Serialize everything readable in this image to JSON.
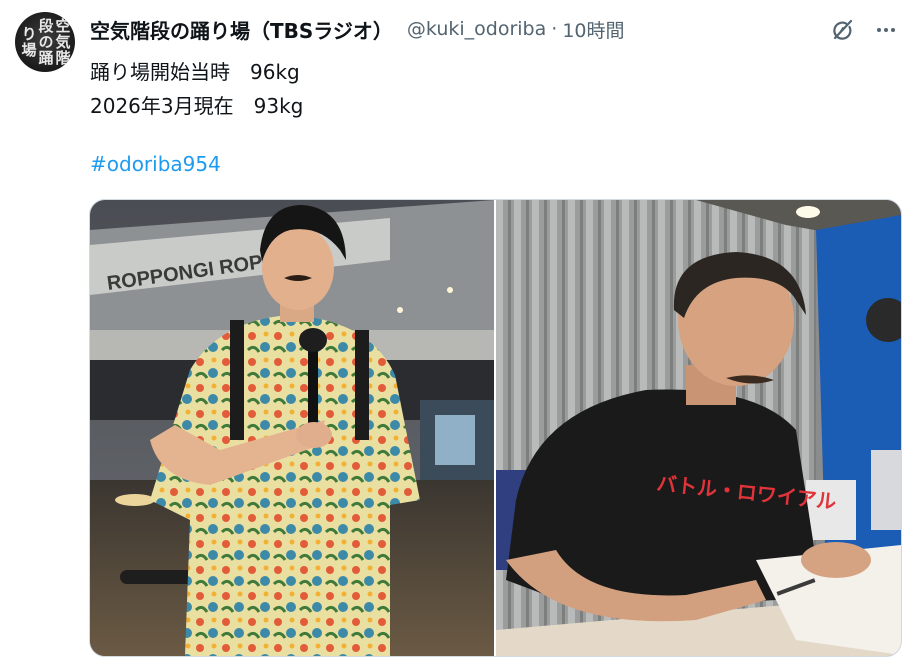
{
  "author": {
    "name": "空気階段の踊り場（TBSラジオ）",
    "handle": "@kuki_odoriba",
    "separator": "·",
    "time": "10時間",
    "avatar_text": "空気階段の踊り場"
  },
  "post": {
    "line1": "踊り場開始当時　96kg",
    "line2": "2026年3月現在　93kg",
    "hashtag": "#odoriba954"
  },
  "media": {
    "photo1": {
      "sign_text": "ROPPONGI ROPPONGI"
    },
    "photo2": {
      "shirt_text": "バトル・ロワイアル"
    }
  },
  "icons": {
    "grok": "grok-icon",
    "more": "more-dots-icon"
  },
  "colors": {
    "link": "#1d9bf0",
    "secondary_text": "#536471",
    "primary_text": "#0f1419",
    "border": "#cfd9de"
  }
}
